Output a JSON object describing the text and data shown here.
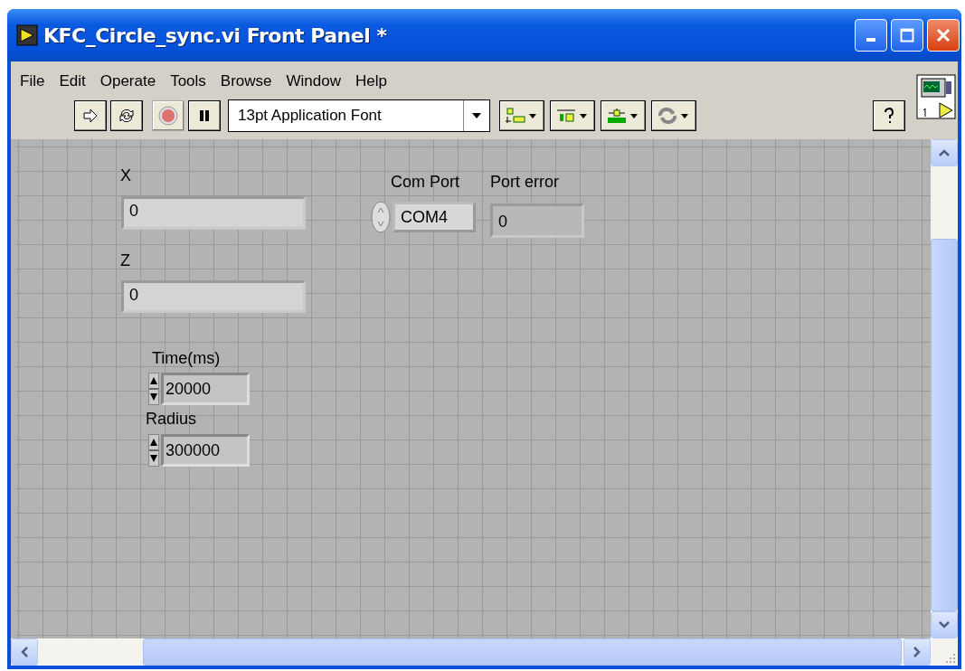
{
  "window": {
    "title": "KFC_Circle_sync.vi Front Panel *"
  },
  "menu": [
    "File",
    "Edit",
    "Operate",
    "Tools",
    "Browse",
    "Window",
    "Help"
  ],
  "toolbar": {
    "font": "13pt Application Font"
  },
  "panel": [
    {
      "kind": "indicator",
      "label": "X",
      "value": "0"
    },
    {
      "kind": "indicator",
      "label": "Z",
      "value": "0"
    },
    {
      "kind": "ring",
      "label": "Com Port",
      "value": "COM4"
    },
    {
      "kind": "indicator",
      "label": "Port error",
      "value": "0"
    },
    {
      "kind": "numeric",
      "label": "Time(ms)",
      "value": "20000"
    },
    {
      "kind": "numeric",
      "label": "Radius",
      "value": "300000"
    }
  ]
}
